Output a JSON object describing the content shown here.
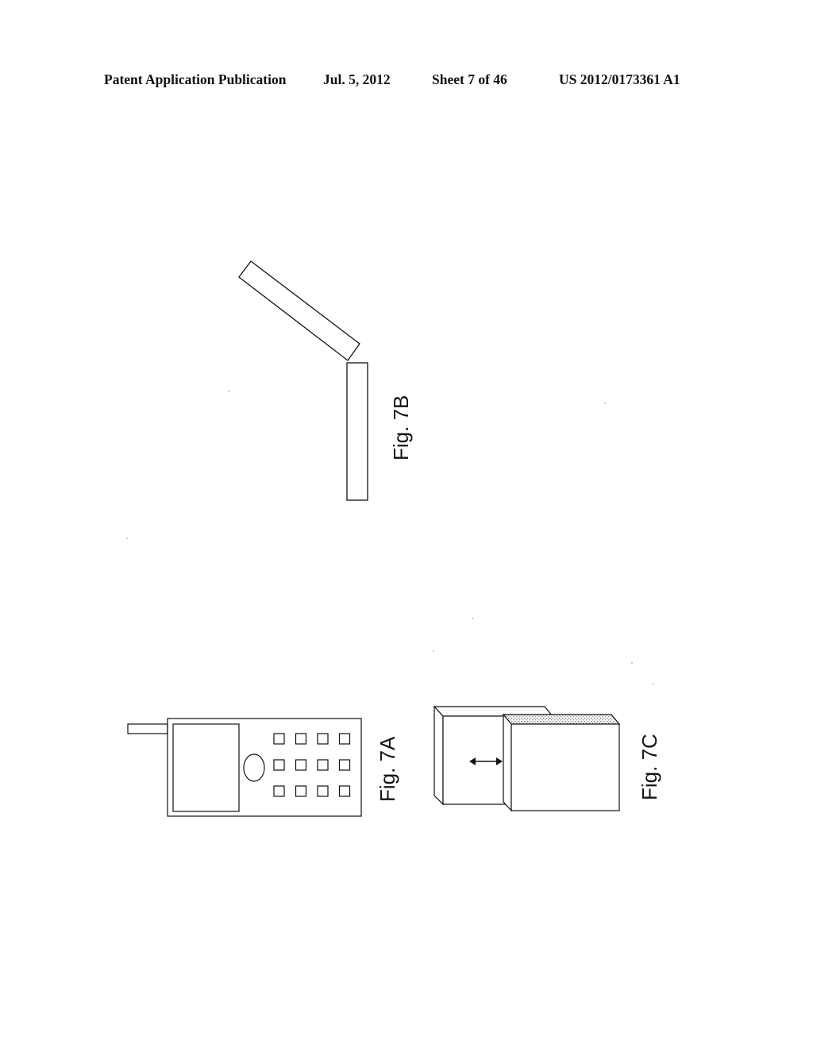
{
  "header": {
    "publication_type": "Patent Application Publication",
    "date": "Jul. 5, 2012",
    "sheet": "Sheet 7 of 46",
    "publication_number": "US 2012/0173361 A1"
  },
  "figures": [
    {
      "id": "7A",
      "label": "Fig. 7A",
      "depicts": "candy-bar mobile phone with antenna, display, navigation button and 12-key keypad",
      "keypad": {
        "rows": 3,
        "columns": 4
      }
    },
    {
      "id": "7B",
      "label": "Fig. 7B",
      "depicts": "clamshell device with upper panel opened at an angle over a lower panel"
    },
    {
      "id": "7C",
      "label": "Fig. 7C",
      "depicts": "slider device with two stacked blocks and a double-headed arrow indicating sliding motion"
    }
  ],
  "colors": {
    "ink": "#111111",
    "paper": "#ffffff",
    "stipple": "#bdbdbd"
  }
}
